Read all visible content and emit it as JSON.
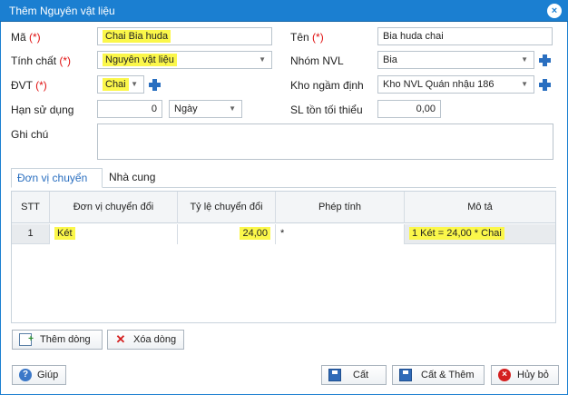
{
  "window": {
    "title": "Thêm Nguyên vật liệu",
    "close_glyph": "×"
  },
  "form": {
    "ma": {
      "label": "Mã",
      "required": "(*)",
      "value": "Chai Bia huda"
    },
    "ten": {
      "label": "Tên",
      "required": "(*)",
      "value": "Bia huda chai"
    },
    "tinh_chat": {
      "label": "Tính chất",
      "required": "(*)",
      "value": "Nguyên vật liệu"
    },
    "nhom_nvl": {
      "label": "Nhóm NVL",
      "value": "Bia"
    },
    "dvt": {
      "label": "ĐVT",
      "required": "(*)",
      "value": "Chai"
    },
    "kho_ngam_dinh": {
      "label": "Kho ngầm định",
      "value": "Kho NVL Quán nhậu 186"
    },
    "han_su_dung": {
      "label": "Hạn sử dụng",
      "value": "0",
      "unit": "Ngày"
    },
    "sl_ton_toi_thieu": {
      "label": "SL tồn tối thiểu",
      "value": "0,00"
    },
    "ghi_chu": {
      "label": "Ghi chú",
      "value": ""
    }
  },
  "tabs": [
    {
      "label": "Đơn vị chuyển đổi",
      "active": true
    },
    {
      "label": "Nhà cung cấp",
      "active": false
    }
  ],
  "grid": {
    "columns": [
      "STT",
      "Đơn vị chuyển đổi",
      "Tỷ lệ chuyển đổi",
      "Phép tính",
      "Mô tả"
    ],
    "rows": [
      {
        "stt": "1",
        "don_vi": "Két",
        "ty_le": "24,00",
        "phep_tinh": "*",
        "mo_ta": "1 Két = 24,00 * Chai"
      }
    ]
  },
  "grid_buttons": {
    "add_row": "Thêm dòng",
    "delete_row": "Xóa dòng"
  },
  "footer": {
    "help": "Giúp",
    "save": "Cất",
    "save_add": "Cất & Thêm",
    "cancel": "Hủy bỏ"
  },
  "icons": {
    "close": "close-icon",
    "dropdown": "chevron-down-icon",
    "add": "plus-icon",
    "add_row": "add-row-icon",
    "delete_row": "delete-icon",
    "help": "help-icon",
    "save": "save-icon",
    "cancel": "cancel-icon"
  },
  "colors": {
    "title_bar": "#1b7fd1",
    "required": "#e01010",
    "highlight": "#fbf74a",
    "accent": "#2a6fc0"
  }
}
